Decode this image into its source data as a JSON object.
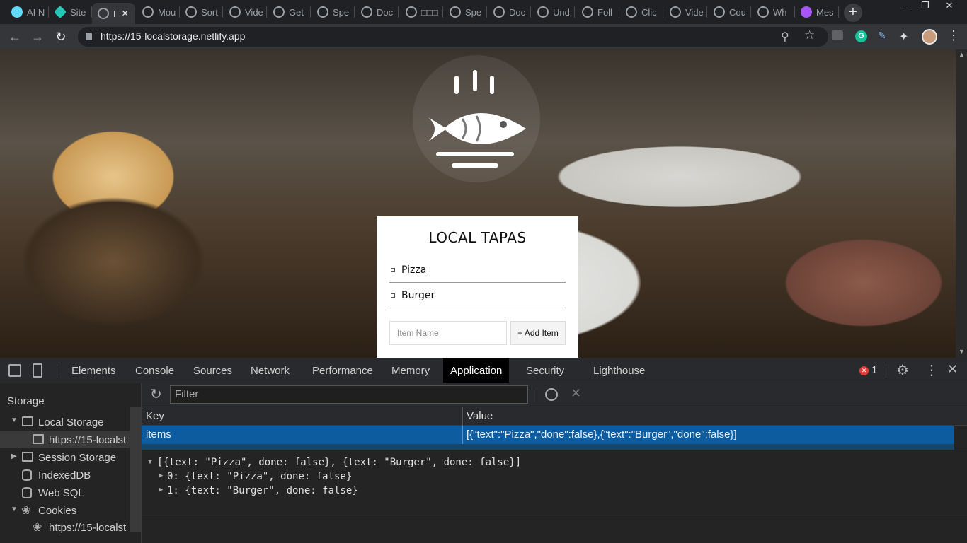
{
  "browser": {
    "tabs": [
      {
        "label": "AI N",
        "icon": "react-icon",
        "color": "#61dafb"
      },
      {
        "label": "Site",
        "icon": "netlify-icon",
        "color": "#25c7b7"
      },
      {
        "label": "I",
        "icon": "globe-icon",
        "color": "#9aa0a6",
        "active": true
      },
      {
        "label": "Mou",
        "icon": "globe-icon",
        "color": "#9aa0a6"
      },
      {
        "label": "Sort",
        "icon": "globe-icon",
        "color": "#9aa0a6"
      },
      {
        "label": "Vide",
        "icon": "globe-icon",
        "color": "#9aa0a6"
      },
      {
        "label": "Get",
        "icon": "globe-icon",
        "color": "#9aa0a6"
      },
      {
        "label": "Spe",
        "icon": "globe-icon",
        "color": "#9aa0a6"
      },
      {
        "label": "Doc",
        "icon": "globe-icon",
        "color": "#9aa0a6"
      },
      {
        "label": "□□□",
        "icon": "globe-icon",
        "color": "#9aa0a6"
      },
      {
        "label": "Spe",
        "icon": "globe-icon",
        "color": "#9aa0a6"
      },
      {
        "label": "Doc",
        "icon": "globe-icon",
        "color": "#9aa0a6"
      },
      {
        "label": "Und",
        "icon": "globe-icon",
        "color": "#9aa0a6"
      },
      {
        "label": "Foll",
        "icon": "globe-icon",
        "color": "#9aa0a6"
      },
      {
        "label": "Clic",
        "icon": "globe-icon",
        "color": "#9aa0a6"
      },
      {
        "label": "Vide",
        "icon": "globe-icon",
        "color": "#9aa0a6"
      },
      {
        "label": "Cou",
        "icon": "globe-icon",
        "color": "#9aa0a6"
      },
      {
        "label": "Wh",
        "icon": "globe-icon",
        "color": "#9aa0a6"
      },
      {
        "label": "Mes",
        "icon": "messenger-icon",
        "color": "#a855f7"
      }
    ],
    "url": "https://15-localstorage.netlify.app"
  },
  "page": {
    "title": "LOCAL TAPAS",
    "items": [
      "Pizza",
      "Burger"
    ],
    "input_placeholder": "Item Name",
    "add_button": "+ Add Item"
  },
  "devtools": {
    "tabs": [
      "Elements",
      "Console",
      "Sources",
      "Network",
      "Performance",
      "Memory",
      "Application",
      "Security",
      "Lighthouse"
    ],
    "active_tab": "Application",
    "error_count": "1",
    "sidebar": {
      "heading": "Storage",
      "local_storage": "Local Storage",
      "local_storage_origin": "https://15-localst",
      "session_storage": "Session Storage",
      "indexeddb": "IndexedDB",
      "websql": "Web SQL",
      "cookies": "Cookies",
      "cookies_origin": "https://15-localst"
    },
    "filter_placeholder": "Filter",
    "table": {
      "key_header": "Key",
      "value_header": "Value",
      "row_key": "items",
      "row_value": "[{\"text\":\"Pizza\",\"done\":false},{\"text\":\"Burger\",\"done\":false}]"
    },
    "preview": {
      "root": "[{text: \"Pizza\", done: false}, {text: \"Burger\", done: false}]",
      "child0": "0: {text: \"Pizza\", done: false}",
      "child1": "1: {text: \"Burger\", done: false}"
    }
  }
}
